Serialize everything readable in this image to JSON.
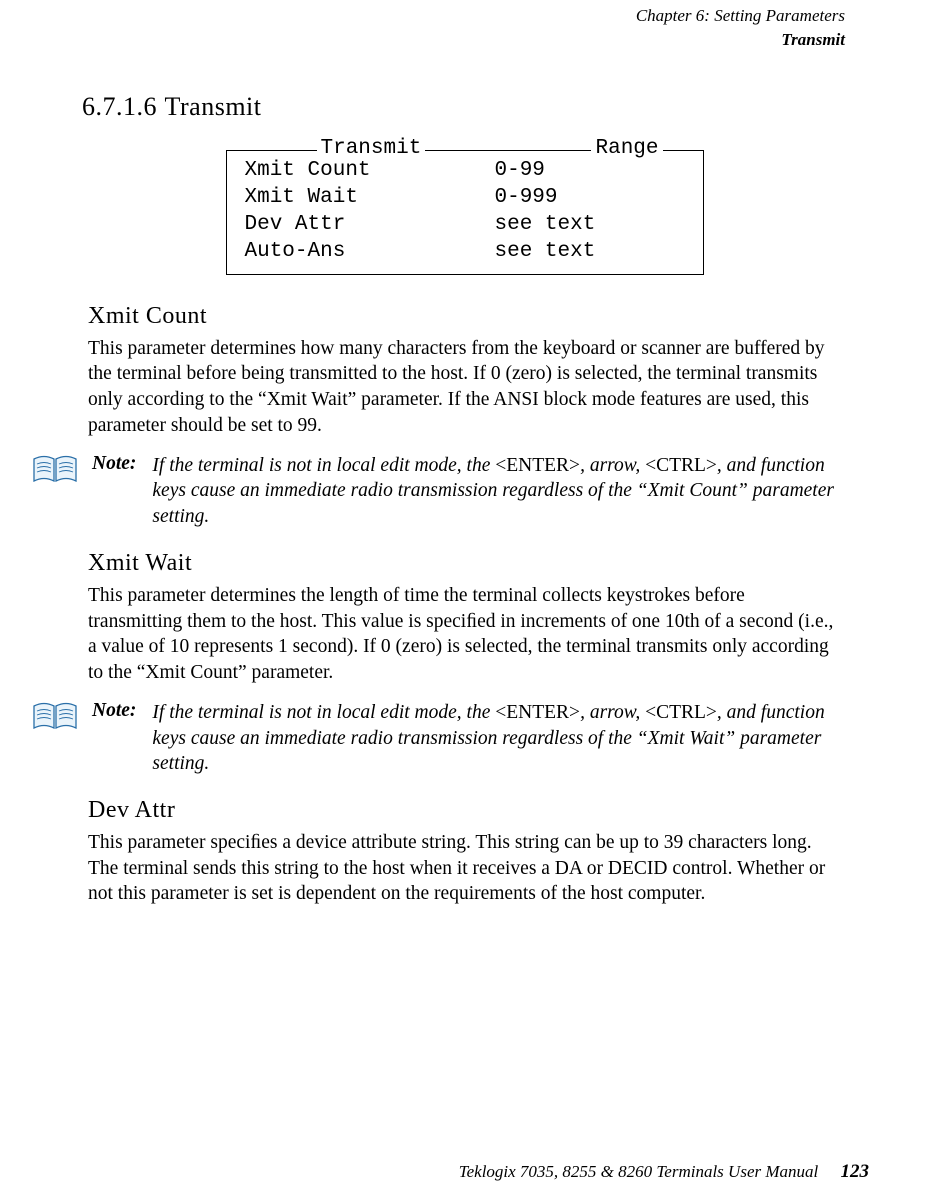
{
  "header": {
    "chapter": "Chapter 6: Setting Parameters",
    "topic": "Transmit"
  },
  "section": {
    "number": "6.7.1.6",
    "title": "Transmit"
  },
  "param_table": {
    "legend_left": "Transmit",
    "legend_right": "Range",
    "rows": [
      {
        "name": "Xmit Count",
        "range": "0-99"
      },
      {
        "name": "Xmit Wait",
        "range": "0-999"
      },
      {
        "name": "Dev Attr",
        "range": "see text"
      },
      {
        "name": "Auto-Ans",
        "range": "see text"
      }
    ]
  },
  "xmit_count": {
    "heading": "Xmit Count",
    "body": "This parameter determines how many characters from the keyboard or scanner are buffered by the terminal before being transmitted to the host. If 0 (zero) is selected, the terminal transmits only according to the “Xmit Wait” parameter. If the ANSI block mode features are used, this parameter should be set to 99."
  },
  "note1": {
    "label": "Note:",
    "pre": "If the terminal is not in local edit mode, the ",
    "k1": "<ENTER>",
    "mid": ", arrow, ",
    "k2": "<CTRL>",
    "post": ", and function keys cause an immediate radio transmission regardless of the “Xmit Count” parameter setting."
  },
  "xmit_wait": {
    "heading": "Xmit Wait",
    "body": "This parameter determines the length of time the terminal collects keystrokes before transmitting them to the host. This value is speciﬁed in increments of one 10th of a second (i.e., a value of 10 represents 1 second). If 0 (zero) is selected, the terminal transmits only according to the “Xmit Count” parameter."
  },
  "note2": {
    "label": "Note:",
    "pre": "If the terminal is not in local edit mode, the ",
    "k1": "<ENTER>",
    "mid": ", arrow, ",
    "k2": "<CTRL>",
    "post": ", and function keys cause an immediate radio transmission regardless of the “Xmit Wait” parameter setting."
  },
  "dev_attr": {
    "heading": "Dev Attr",
    "body": "This parameter speciﬁes a device attribute string. This string can be up to 39 characters long. The terminal sends this string to the host when it receives a DA or DECID control. Whether or not this parameter is set is dependent on the requirements of the host computer."
  },
  "footer": {
    "text": "Teklogix 7035, 8255 & 8260 Terminals User Manual",
    "page": "123"
  }
}
